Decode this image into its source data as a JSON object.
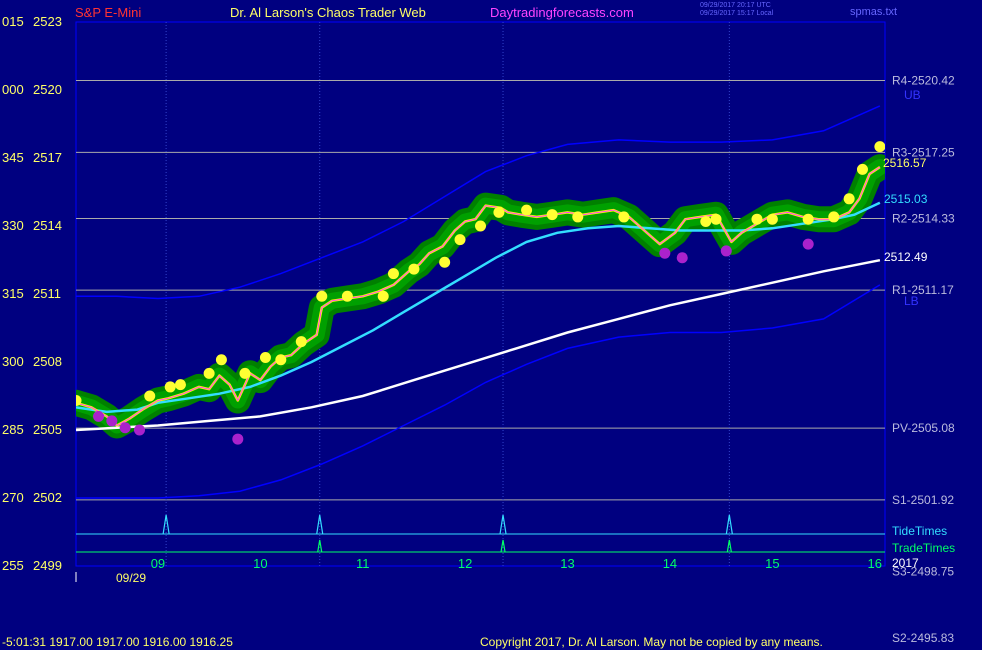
{
  "header": {
    "symbol": "S&P E-Mini",
    "site_title": "Dr. Al Larson's Chaos Trader Web",
    "url": "Daytradingforecasts.com",
    "timestamp_utc": "09/29/2017 20:17 UTC",
    "timestamp_local": "09/29/2017 15:17 Local",
    "file": "spmas.txt"
  },
  "footer": {
    "quote": "-5:01:31 1917.00 1917.00 1916.00 1916.25",
    "copyright": "Copyright 2017, Dr. Al Larson. May not be copied by any means."
  },
  "chart_data": {
    "type": "line",
    "ylim": [
      2499,
      2523
    ],
    "xlim": [
      8.2,
      16.1
    ],
    "x_ticks": [
      "09",
      "10",
      "11",
      "12",
      "13",
      "14",
      "15",
      "16"
    ],
    "x_tick_values": [
      9,
      10,
      11,
      12,
      13,
      14,
      15,
      16
    ],
    "date_label": "09/29",
    "year_label": "2017",
    "y_ticks": [
      {
        "value": 2523,
        "left": "015",
        "right": "2523"
      },
      {
        "value": 2520,
        "left": "000",
        "right": "2520"
      },
      {
        "value": 2517,
        "left": "345",
        "right": "2517"
      },
      {
        "value": 2514,
        "left": "330",
        "right": "2514"
      },
      {
        "value": 2511,
        "left": "315",
        "right": "2511"
      },
      {
        "value": 2508,
        "left": "300",
        "right": "2508"
      },
      {
        "value": 2505,
        "left": "285",
        "right": "2505"
      },
      {
        "value": 2502,
        "left": "270",
        "right": "2502"
      },
      {
        "value": 2499,
        "left": "255",
        "right": "2499"
      }
    ],
    "levels": [
      {
        "label": "R4-2520.42",
        "value": 2520.42
      },
      {
        "label": "R3-2517.25",
        "value": 2517.25
      },
      {
        "label": "R2-2514.33",
        "value": 2514.33
      },
      {
        "label": "R1-2511.17",
        "value": 2511.17
      },
      {
        "label": "PV-2505.08",
        "value": 2505.08
      },
      {
        "label": "S1-2501.92",
        "value": 2501.92
      },
      {
        "label": "S3-2498.75",
        "value": 2498.75
      },
      {
        "label": "S2-2495.83",
        "value": 2495.83
      }
    ],
    "band_labels": {
      "upper": "UB",
      "lower": "LB"
    },
    "last_values": {
      "price": "2516.57",
      "fast_ma": "2515.03",
      "slow_ma": "2512.49"
    },
    "tide_times": [
      9.08,
      10.58,
      12.37,
      14.58
    ],
    "trade_times": [
      10.58,
      12.37,
      14.58
    ],
    "legend": [
      "TideTimes",
      "TradeTimes"
    ],
    "colors": {
      "background": "#000080",
      "price": "#ffff00",
      "price_inner": "#ff44ff",
      "glow": "#00a000",
      "glow_dark": "#008000",
      "highs": "#ffff33",
      "lows": "#aa22cc",
      "fast_ma": "#33ddff",
      "slow_ma": "#ffffff",
      "bands": "#0000ff",
      "grid": "#aaaaaa",
      "tide": "#33ddff",
      "trade": "#00ff66"
    },
    "series": [
      {
        "name": "price",
        "x": [
          8.2,
          8.35,
          8.5,
          8.6,
          8.72,
          8.85,
          9.0,
          9.1,
          9.25,
          9.4,
          9.5,
          9.6,
          9.7,
          9.78,
          9.9,
          10.0,
          10.1,
          10.2,
          10.3,
          10.42,
          10.55,
          10.6,
          10.7,
          10.85,
          11.0,
          11.15,
          11.3,
          11.45,
          11.55,
          11.65,
          11.78,
          11.9,
          12.0,
          12.1,
          12.2,
          12.35,
          12.42,
          12.55,
          12.7,
          12.85,
          13.0,
          13.15,
          13.3,
          13.45,
          13.6,
          13.75,
          13.9,
          14.05,
          14.15,
          14.3,
          14.45,
          14.6,
          14.7,
          14.85,
          15.0,
          15.15,
          15.3,
          15.45,
          15.6,
          15.75,
          15.85,
          15.95,
          16.05
        ],
        "y": [
          2506.2,
          2506.0,
          2505.6,
          2505.2,
          2505.5,
          2505.9,
          2506.3,
          2506.4,
          2506.6,
          2506.9,
          2506.8,
          2507.4,
          2507.0,
          2506.3,
          2507.5,
          2507.2,
          2507.8,
          2508.2,
          2508.3,
          2508.8,
          2509.2,
          2510.4,
          2510.7,
          2510.8,
          2510.9,
          2511.1,
          2511.4,
          2512.0,
          2512.3,
          2512.8,
          2513.1,
          2513.8,
          2514.2,
          2514.3,
          2514.9,
          2514.8,
          2514.6,
          2514.5,
          2514.4,
          2514.5,
          2514.6,
          2514.5,
          2514.6,
          2514.7,
          2514.4,
          2513.8,
          2513.2,
          2513.7,
          2514.3,
          2514.4,
          2514.5,
          2513.3,
          2513.7,
          2514.1,
          2514.5,
          2514.6,
          2514.4,
          2514.3,
          2514.3,
          2514.6,
          2515.2,
          2516.3,
          2516.6
        ]
      },
      {
        "name": "fast_ma",
        "x": [
          8.2,
          8.5,
          8.8,
          9.0,
          9.3,
          9.6,
          9.9,
          10.2,
          10.5,
          10.8,
          11.1,
          11.4,
          11.7,
          12.0,
          12.3,
          12.6,
          12.9,
          13.2,
          13.5,
          13.8,
          14.1,
          14.4,
          14.7,
          15.0,
          15.3,
          15.6,
          15.8,
          16.05
        ],
        "y": [
          2506.0,
          2505.8,
          2505.9,
          2506.2,
          2506.4,
          2506.6,
          2506.9,
          2507.4,
          2508.0,
          2508.7,
          2509.4,
          2510.2,
          2511.0,
          2511.8,
          2512.6,
          2513.3,
          2513.7,
          2513.9,
          2514.0,
          2513.9,
          2513.8,
          2513.8,
          2513.8,
          2513.9,
          2514.1,
          2514.3,
          2514.5,
          2515.03
        ]
      },
      {
        "name": "slow_ma",
        "x": [
          8.2,
          8.6,
          9.0,
          9.5,
          10.0,
          10.5,
          11.0,
          11.5,
          12.0,
          12.5,
          13.0,
          13.5,
          14.0,
          14.5,
          15.0,
          15.5,
          16.05
        ],
        "y": [
          2505.0,
          2505.1,
          2505.2,
          2505.4,
          2505.6,
          2506.0,
          2506.5,
          2507.2,
          2507.9,
          2508.6,
          2509.3,
          2509.9,
          2510.5,
          2511.0,
          2511.5,
          2512.0,
          2512.49
        ]
      },
      {
        "name": "upper_band",
        "x": [
          8.2,
          8.6,
          9.0,
          9.4,
          9.8,
          10.2,
          10.6,
          11.0,
          11.4,
          11.8,
          12.2,
          12.6,
          13.0,
          13.5,
          14.0,
          14.5,
          15.0,
          15.5,
          16.05
        ],
        "y": [
          2510.9,
          2510.9,
          2510.8,
          2510.9,
          2511.3,
          2511.9,
          2512.6,
          2513.3,
          2514.2,
          2515.3,
          2516.4,
          2517.1,
          2517.6,
          2517.8,
          2517.7,
          2517.7,
          2517.8,
          2518.2,
          2519.3
        ]
      },
      {
        "name": "lower_band",
        "x": [
          8.2,
          8.6,
          9.0,
          9.4,
          9.8,
          10.2,
          10.6,
          11.0,
          11.4,
          11.8,
          12.2,
          12.6,
          13.0,
          13.5,
          14.0,
          14.5,
          15.0,
          15.5,
          16.05
        ],
        "y": [
          2502.0,
          2502.0,
          2502.0,
          2502.1,
          2502.3,
          2502.8,
          2503.5,
          2504.3,
          2505.2,
          2506.1,
          2507.1,
          2507.9,
          2508.6,
          2509.1,
          2509.3,
          2509.3,
          2509.5,
          2509.9,
          2511.4
        ]
      }
    ],
    "highs": {
      "x": [
        8.2,
        8.92,
        9.12,
        9.22,
        9.5,
        9.62,
        9.85,
        10.05,
        10.2,
        10.4,
        10.6,
        10.85,
        11.2,
        11.3,
        11.5,
        11.8,
        11.95,
        12.15,
        12.33,
        12.6,
        12.85,
        13.1,
        13.55,
        14.35,
        14.45,
        14.85,
        15.0,
        15.35,
        15.6,
        15.75,
        15.88,
        16.05
      ],
      "y": [
        2506.3,
        2506.5,
        2506.9,
        2507.0,
        2507.5,
        2508.1,
        2507.5,
        2508.2,
        2508.1,
        2508.9,
        2510.9,
        2510.9,
        2510.9,
        2511.9,
        2512.1,
        2512.4,
        2513.4,
        2514.0,
        2514.6,
        2514.7,
        2514.5,
        2514.4,
        2514.4,
        2514.2,
        2514.3,
        2514.3,
        2514.3,
        2514.3,
        2514.4,
        2515.2,
        2516.5,
        2517.5
      ]
    },
    "lows": {
      "x": [
        8.42,
        8.55,
        8.68,
        8.82,
        9.78,
        13.95,
        14.12,
        14.55,
        15.35
      ],
      "y": [
        2505.6,
        2505.4,
        2505.1,
        2505.0,
        2504.6,
        2512.8,
        2512.6,
        2512.9,
        2513.2
      ]
    }
  }
}
